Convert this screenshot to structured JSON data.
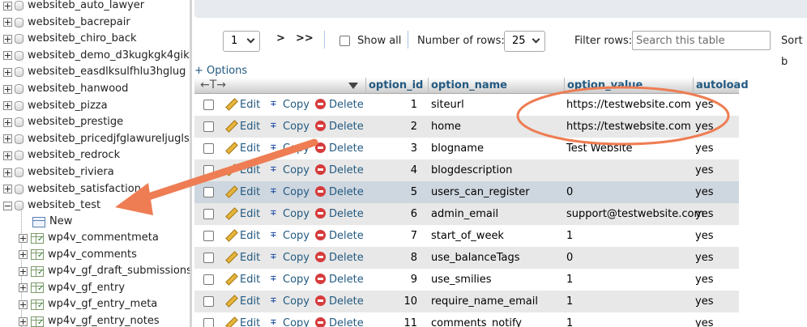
{
  "sidebar": {
    "databases": [
      {
        "label": "websiteb_auto_lawyer",
        "expanded": false
      },
      {
        "label": "websiteb_bacrepair",
        "expanded": false
      },
      {
        "label": "websiteb_chiro_back",
        "expanded": false
      },
      {
        "label": "websiteb_demo_d3kugkgk4gik3g",
        "expanded": false
      },
      {
        "label": "websiteb_easdlksulfhlu3hglug",
        "expanded": false
      },
      {
        "label": "websiteb_hanwood",
        "expanded": false
      },
      {
        "label": "websiteb_pizza",
        "expanded": false
      },
      {
        "label": "websiteb_prestige",
        "expanded": false
      },
      {
        "label": "websiteb_pricedjfglawureljugls",
        "expanded": false
      },
      {
        "label": "websiteb_redrock",
        "expanded": false
      },
      {
        "label": "websiteb_riviera",
        "expanded": false
      },
      {
        "label": "websiteb_satisfaction",
        "expanded": false
      },
      {
        "label": "websiteb_test",
        "expanded": true
      }
    ],
    "new_label": "New",
    "tables": [
      "wp4v_commentmeta",
      "wp4v_comments",
      "wp4v_gf_draft_submissions",
      "wp4v_gf_entry",
      "wp4v_gf_entry_meta",
      "wp4v_gf_entry_notes"
    ]
  },
  "controls": {
    "page_value": "1",
    "next_label": ">",
    "last_label": ">>",
    "show_all_label": "Show all",
    "rows_label": "Number of rows:",
    "rows_value": "25",
    "filter_label": "Filter rows:",
    "filter_placeholder": "Search this table",
    "sort_label": "Sort b"
  },
  "options_link": "+ Options",
  "table": {
    "sort_arrows": "←T→",
    "columns": [
      "option_id",
      "option_name",
      "option_value",
      "autoload"
    ],
    "actions": {
      "edit": "Edit",
      "copy": "Copy",
      "delete": "Delete"
    },
    "rows": [
      {
        "option_id": "1",
        "option_name": "siteurl",
        "option_value": "https://testwebsite.com",
        "autoload": "yes"
      },
      {
        "option_id": "2",
        "option_name": "home",
        "option_value": "https://testwebsite.com",
        "autoload": "yes"
      },
      {
        "option_id": "3",
        "option_name": "blogname",
        "option_value": "Test Website",
        "autoload": "yes"
      },
      {
        "option_id": "4",
        "option_name": "blogdescription",
        "option_value": "",
        "autoload": "yes"
      },
      {
        "option_id": "5",
        "option_name": "users_can_register",
        "option_value": "0",
        "autoload": "yes"
      },
      {
        "option_id": "6",
        "option_name": "admin_email",
        "option_value": "support@testwebsite.com",
        "autoload": "yes"
      },
      {
        "option_id": "7",
        "option_name": "start_of_week",
        "option_value": "1",
        "autoload": "yes"
      },
      {
        "option_id": "8",
        "option_name": "use_balanceTags",
        "option_value": "0",
        "autoload": "yes"
      },
      {
        "option_id": "9",
        "option_name": "use_smilies",
        "option_value": "1",
        "autoload": "yes"
      },
      {
        "option_id": "10",
        "option_name": "require_name_email",
        "option_value": "1",
        "autoload": "yes"
      },
      {
        "option_id": "11",
        "option_name": "comments_notify",
        "option_value": "1",
        "autoload": "yes"
      }
    ]
  },
  "colors": {
    "link": "#235a81",
    "annotation": "#ee7d53",
    "row_hover": "#ced6df",
    "row_even": "#e8e8e8"
  }
}
